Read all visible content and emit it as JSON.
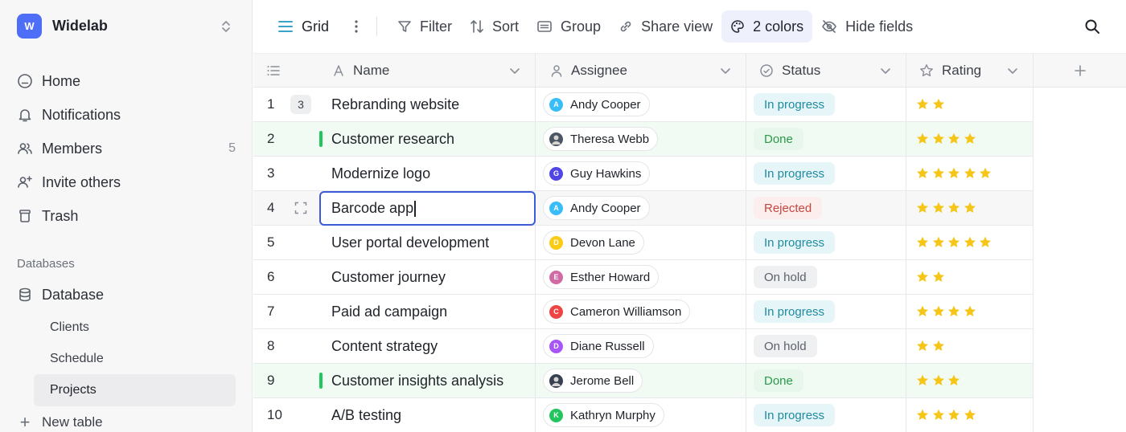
{
  "workspace": {
    "initial": "W",
    "name": "Widelab"
  },
  "nav": [
    {
      "icon": "home-icon",
      "label": "Home"
    },
    {
      "icon": "bell-icon",
      "label": "Notifications"
    },
    {
      "icon": "members-icon",
      "label": "Members",
      "count": "5"
    },
    {
      "icon": "invite-icon",
      "label": "Invite others"
    },
    {
      "icon": "trash-icon",
      "label": "Trash"
    }
  ],
  "databases": {
    "section_label": "Databases",
    "db_label": "Database",
    "tables": [
      "Clients",
      "Schedule",
      "Projects"
    ],
    "active_table": "Projects",
    "new_table_label": "New table"
  },
  "toolbar": {
    "view_label": "Grid",
    "filter_label": "Filter",
    "sort_label": "Sort",
    "group_label": "Group",
    "share_label": "Share view",
    "colors_label": "2 colors",
    "hide_label": "Hide fields"
  },
  "columns": {
    "name": "Name",
    "assignee": "Assignee",
    "status": "Status",
    "rating": "Rating"
  },
  "colors": {
    "accent": "#4f6ef7",
    "green_row": "#f1faf3",
    "star": "#f5c518"
  },
  "rows": [
    {
      "num": "1",
      "badge": "3",
      "name": "Rebranding website",
      "assignee": "Andy Cooper",
      "initial": "A",
      "avatar_color": "#38bdf8",
      "status": "In progress",
      "status_kind": "prog",
      "rating": 2
    },
    {
      "num": "2",
      "name": "Customer research",
      "assignee": "Theresa Webb",
      "initial": "",
      "avatar_color": "#4b5563",
      "status": "Done",
      "status_kind": "done",
      "rating": 4,
      "green": true
    },
    {
      "num": "3",
      "name": "Modernize logo",
      "assignee": "Guy Hawkins",
      "initial": "G",
      "avatar_color": "#4f46e5",
      "status": "In progress",
      "status_kind": "prog",
      "rating": 5
    },
    {
      "num": "4",
      "name": "Barcode app",
      "assignee": "Andy Cooper",
      "initial": "A",
      "avatar_color": "#38bdf8",
      "status": "Rejected",
      "status_kind": "rej",
      "rating": 4,
      "editing": true
    },
    {
      "num": "5",
      "name": "User portal development",
      "assignee": "Devon Lane",
      "initial": "D",
      "avatar_color": "#facc15",
      "status": "In progress",
      "status_kind": "prog",
      "rating": 5
    },
    {
      "num": "6",
      "name": "Customer journey",
      "assignee": "Esther Howard",
      "initial": "E",
      "avatar_color": "#d16ba5",
      "status": "On hold",
      "status_kind": "hold",
      "rating": 2
    },
    {
      "num": "7",
      "name": "Paid ad campaign",
      "assignee": "Cameron Williamson",
      "initial": "C",
      "avatar_color": "#ef4444",
      "status": "In progress",
      "status_kind": "prog",
      "rating": 4
    },
    {
      "num": "8",
      "name": "Content strategy",
      "assignee": "Diane Russell",
      "initial": "D",
      "avatar_color": "#a855f7",
      "status": "On hold",
      "status_kind": "hold",
      "rating": 2
    },
    {
      "num": "9",
      "name": "Customer insights analysis",
      "assignee": "Jerome Bell",
      "initial": "",
      "avatar_color": "#374151",
      "status": "Done",
      "status_kind": "done",
      "rating": 3,
      "green": true
    },
    {
      "num": "10",
      "name": "A/B testing",
      "assignee": "Kathryn Murphy",
      "initial": "K",
      "avatar_color": "#22c55e",
      "status": "In progress",
      "status_kind": "prog",
      "rating": 4
    }
  ]
}
